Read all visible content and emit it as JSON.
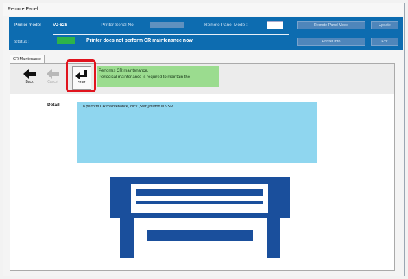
{
  "window": {
    "title": "Remote Panel"
  },
  "header": {
    "printer_model_label": "Printer model :",
    "printer_model_value": "VJ-628",
    "serial_label": "Printer Serial No.",
    "remote_mode_label": "Remote Panel Mode :",
    "buttons": [
      "Remote Panel Mode",
      "Update",
      "Printer Info",
      "Exit"
    ],
    "status_label": "Status :",
    "status_text": "Printer does not perform CR maintenance now.",
    "status_color": "#2db34a",
    "brand_color": "#0d6cb0"
  },
  "tab": {
    "label": "CR Maintenance"
  },
  "toolbar": {
    "back_label": "Back",
    "cancel_label": "Cancel",
    "start_label": "Start",
    "info_line1": "Performs CR maintenance.",
    "info_line2": "Periodical maintenance is required to maintain the"
  },
  "detail": {
    "label": "Detail",
    "text": "To perform CR maintenance, click [Start] button in VSM."
  },
  "icons": {
    "back": "back-arrow-icon",
    "cancel": "cancel-arrow-icon",
    "start": "start-enter-icon",
    "printer": "printer-icon"
  }
}
